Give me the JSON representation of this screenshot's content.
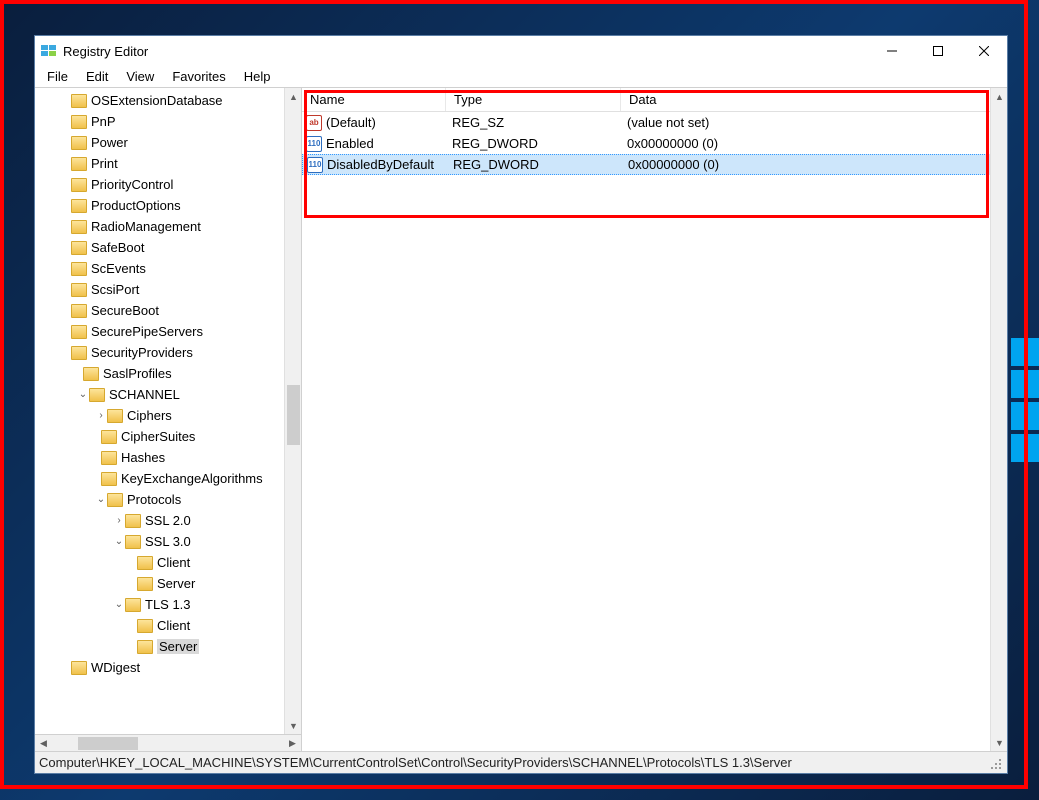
{
  "window_title": "Registry Editor",
  "menus": [
    "File",
    "Edit",
    "View",
    "Favorites",
    "Help"
  ],
  "tree": [
    {
      "indent": 0,
      "exp": "",
      "label": "OSExtensionDatabase"
    },
    {
      "indent": 0,
      "exp": "",
      "label": "PnP"
    },
    {
      "indent": 0,
      "exp": "",
      "label": "Power"
    },
    {
      "indent": 0,
      "exp": "",
      "label": "Print"
    },
    {
      "indent": 0,
      "exp": "",
      "label": "PriorityControl"
    },
    {
      "indent": 0,
      "exp": "",
      "label": "ProductOptions"
    },
    {
      "indent": 0,
      "exp": "",
      "label": "RadioManagement"
    },
    {
      "indent": 0,
      "exp": "",
      "label": "SafeBoot"
    },
    {
      "indent": 0,
      "exp": "",
      "label": "ScEvents"
    },
    {
      "indent": 0,
      "exp": "",
      "label": "ScsiPort"
    },
    {
      "indent": 0,
      "exp": "",
      "label": "SecureBoot"
    },
    {
      "indent": 0,
      "exp": "",
      "label": "SecurePipeServers"
    },
    {
      "indent": 0,
      "exp": "",
      "label": "SecurityProviders"
    },
    {
      "indent": 1,
      "exp": "",
      "label": "SaslProfiles",
      "dotted": true
    },
    {
      "indent": 1,
      "exp": "v",
      "label": "SCHANNEL"
    },
    {
      "indent": 2,
      "exp": ">",
      "label": "Ciphers"
    },
    {
      "indent": 2,
      "exp": "",
      "label": "CipherSuites",
      "dotted": true
    },
    {
      "indent": 2,
      "exp": "",
      "label": "Hashes",
      "dotted": true
    },
    {
      "indent": 2,
      "exp": "",
      "label": "KeyExchangeAlgorithms",
      "dotted": true
    },
    {
      "indent": 2,
      "exp": "v",
      "label": "Protocols"
    },
    {
      "indent": 3,
      "exp": ">",
      "label": "SSL 2.0"
    },
    {
      "indent": 3,
      "exp": "v",
      "label": "SSL 3.0"
    },
    {
      "indent": 4,
      "exp": "",
      "label": "Client",
      "dotted": true
    },
    {
      "indent": 4,
      "exp": "",
      "label": "Server",
      "dotted": true
    },
    {
      "indent": 3,
      "exp": "v",
      "label": "TLS 1.3"
    },
    {
      "indent": 4,
      "exp": "",
      "label": "Client",
      "dotted": true
    },
    {
      "indent": 4,
      "exp": "",
      "label": "Server",
      "sel": true,
      "dotted": true
    },
    {
      "indent": 0,
      "exp": "",
      "label": "WDigest"
    }
  ],
  "columns": {
    "name": "Name",
    "type": "Type",
    "data": "Data"
  },
  "values": [
    {
      "icon": "sz",
      "iconText": "ab",
      "name": "(Default)",
      "type": "REG_SZ",
      "data": "(value not set)",
      "sel": false
    },
    {
      "icon": "dw",
      "iconText": "011\n110",
      "name": "Enabled",
      "type": "REG_DWORD",
      "data": "0x00000000 (0)",
      "sel": false
    },
    {
      "icon": "dw",
      "iconText": "011\n110",
      "name": "DisabledByDefault",
      "type": "REG_DWORD",
      "data": "0x00000000 (0)",
      "sel": true
    }
  ],
  "status_path": "Computer\\HKEY_LOCAL_MACHINE\\SYSTEM\\CurrentControlSet\\Control\\SecurityProviders\\SCHANNEL\\Protocols\\TLS 1.3\\Server"
}
